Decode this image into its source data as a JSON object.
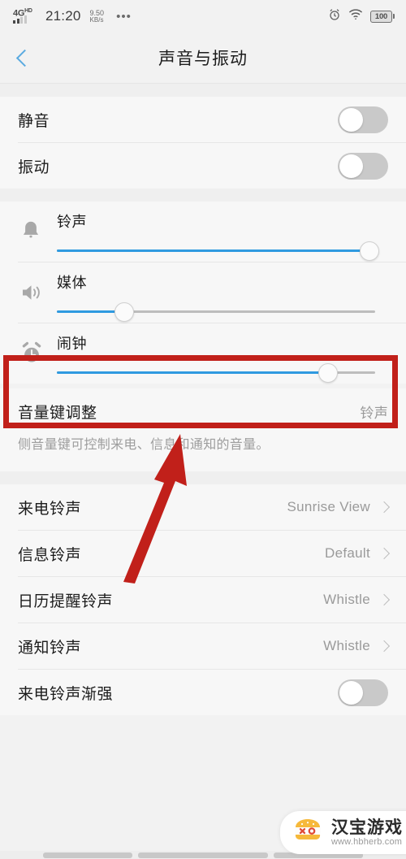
{
  "statusbar": {
    "network_type": "4G",
    "network_sup": "HD",
    "time": "21:20",
    "speed_value": "9.50",
    "speed_unit": "KB/s",
    "overflow": "•••",
    "alarm_icon": "alarm-clock-icon",
    "wifi_icon": "wifi-icon",
    "battery_level": "100"
  },
  "header": {
    "back_icon": "chevron-left-icon",
    "title": "声音与振动"
  },
  "toggles_group": [
    {
      "label": "静音",
      "state": "off"
    },
    {
      "label": "振动",
      "state": "off"
    }
  ],
  "sliders_group": [
    {
      "label": "铃声",
      "icon": "bell-icon",
      "percent": 98
    },
    {
      "label": "媒体",
      "icon": "speaker-icon",
      "percent": 21
    },
    {
      "label": "闹钟",
      "icon": "alarm-clock-icon",
      "percent": 85
    }
  ],
  "volume_key": {
    "label": "音量键调整",
    "value": "铃声",
    "description": "侧音量键可控制来电、信息和通知的音量。"
  },
  "ringtones_group": [
    {
      "label": "来电铃声",
      "value": "Sunrise View"
    },
    {
      "label": "信息铃声",
      "value": "Default"
    },
    {
      "label": "日历提醒铃声",
      "value": "Whistle"
    },
    {
      "label": "通知铃声",
      "value": "Whistle"
    }
  ],
  "fade_in": {
    "label": "来电铃声渐强",
    "state": "off"
  },
  "annotation": {
    "highlight_color": "#c1201a",
    "arrow_color": "#c1201a"
  },
  "watermark": {
    "title": "汉宝游戏",
    "url": "www.hbherb.com",
    "icon": "burger-logo-icon"
  },
  "colors": {
    "accent_blue": "#2f9ae0",
    "back_chevron": "#5aaae0",
    "page_bg": "#f2f2f2",
    "row_bg": "#f7f7f7"
  }
}
